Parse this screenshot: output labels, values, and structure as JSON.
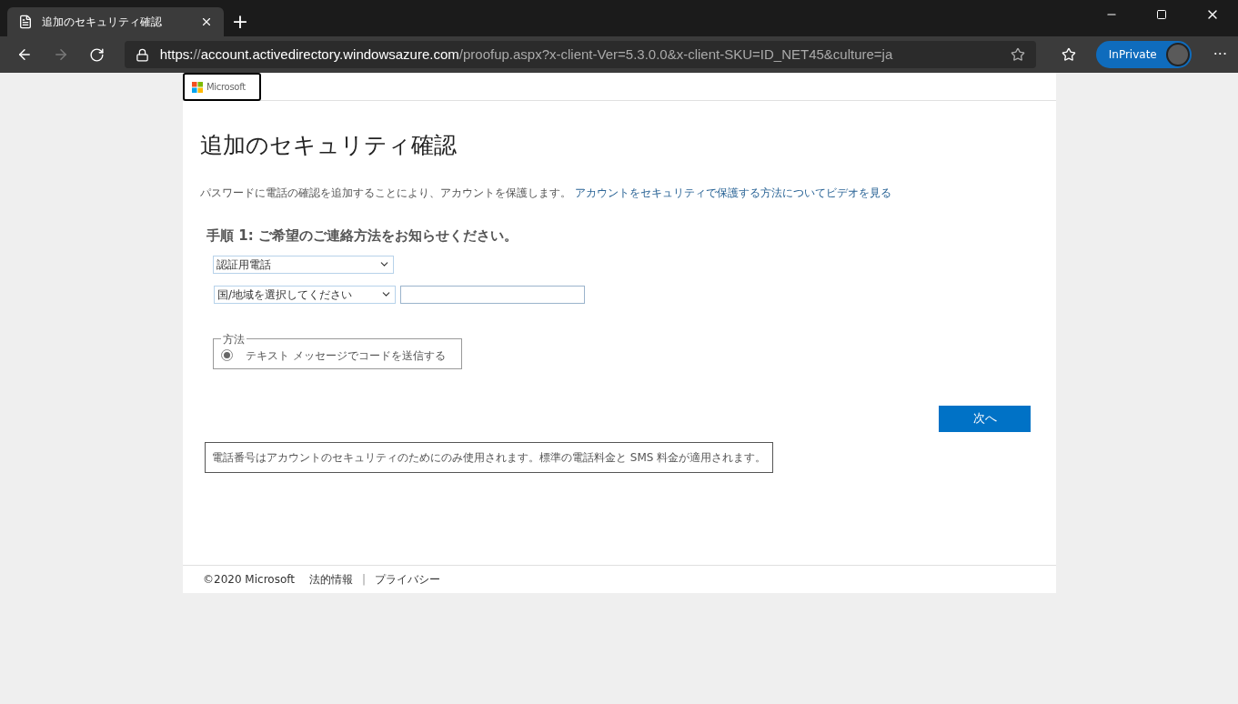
{
  "browser": {
    "tab": {
      "title": "追加のセキュリティ確認",
      "selected": true
    },
    "new_tab": "+",
    "url": {
      "scheme": "https:",
      "separator": "//",
      "host": "account.activedirectory.windowsazure.com",
      "path": "/proofup.aspx?x-client-Ver=5.3.0.0&x-client-SKU=ID_NET45&culture=ja"
    },
    "inprivate": "InPrivate",
    "more": "···"
  },
  "header": {
    "logo": "Microsoft"
  },
  "page": {
    "title": "追加のセキュリティ確認",
    "intro": "パスワードに電話の確認を追加することにより、アカウントを保護します。",
    "video_link": "アカウントをセキュリティで保護する方法についてビデオを見る",
    "step_heading": "手順 1: ご希望のご連絡方法をお知らせください。",
    "contact_select": "認証用電話",
    "country_select": "国/地域を選択してください",
    "method_legend": "方法",
    "methods": [
      {
        "label": "テキスト メッセージでコードを送信する",
        "selected": true
      }
    ],
    "next_button": "次へ",
    "notice": "電話番号はアカウントのセキュリティのためにのみ使用されます。標準の電話料金と SMS 料金が適用されます。"
  },
  "footer": {
    "copyright": "©2020 Microsoft",
    "links": [
      "法的情報",
      "プライバシー"
    ],
    "separator": "|"
  }
}
